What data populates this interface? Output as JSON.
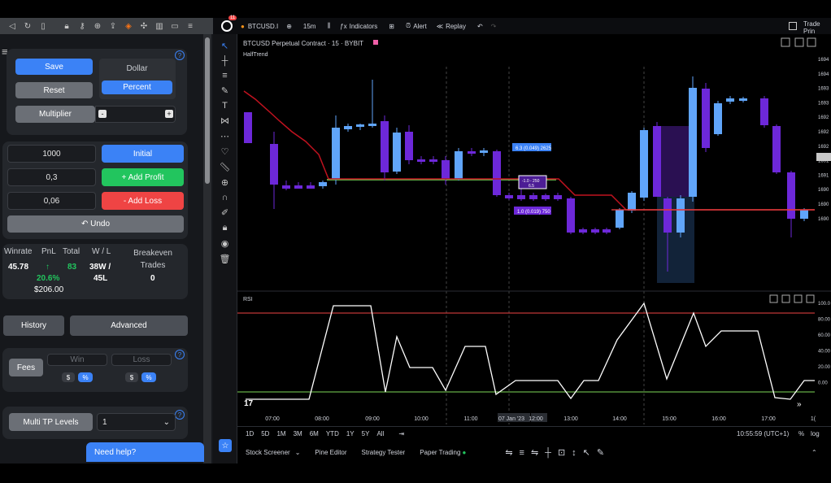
{
  "browser": {
    "icons": [
      "back-icon",
      "reload-icon",
      "bookmark-icon",
      "lock-icon",
      "key-icon",
      "zoom-icon",
      "share-icon",
      "brave-icon",
      "extensions-icon",
      "sidebar-icon",
      "wallet-icon",
      "menu-icon"
    ]
  },
  "panel": {
    "save": "Save",
    "reset": "Reset",
    "dollar": "Dollar",
    "percent": "Percent",
    "multiplier": "Multiplier",
    "minus": "-",
    "plus": "+",
    "input1": "1000",
    "initial": "Initial",
    "input2": "0,3",
    "add_profit": "+ Add Profit",
    "input3": "0,06",
    "add_loss": "- Add Loss",
    "undo": "↶ Undo",
    "stats": {
      "winrate_h": "Winrate",
      "pnl_h": "PnL",
      "total_h": "Total",
      "wl_h": "W / L",
      "be_h": "Breakeven Trades",
      "winrate": "45.78",
      "pnl_arrow": "↑",
      "pnl": "20.6%",
      "pnl_usd": "$206.00",
      "total": "83",
      "wins": "38W /",
      "losses": "45L",
      "be": "0"
    },
    "history": "History",
    "advanced": "Advanced",
    "fees": "Fees",
    "win": "Win",
    "loss": "Loss",
    "dollar_sym": "$",
    "pct_sym": "%",
    "multi_tp": "Multi TP Levels",
    "tp_value": "1",
    "help": "?",
    "need_help": "Need help?"
  },
  "chart": {
    "badge": "11",
    "symbol": "BTCUSD.I",
    "timeframe": "15m",
    "indicators": "Indicators",
    "alert": "Alert",
    "replay": "Replay",
    "trade_label": "Trade Prin",
    "title": "BTCUSD Perpetual Contract · 15 · BYBIT",
    "indicator": "HalfTrend",
    "rsi": "RSI",
    "time_labels": [
      "07:00",
      "08:00",
      "09:00",
      "10:00",
      "11:00",
      "07 Jan '23",
      "12:00",
      "13:00",
      "14:00",
      "15:00",
      "16:00",
      "17:00",
      "1("
    ],
    "ranges": [
      "1D",
      "5D",
      "1M",
      "3M",
      "6M",
      "YTD",
      "1Y",
      "5Y",
      "All"
    ],
    "clock": "10:55:59 (UTC+1)",
    "pct": "%",
    "log": "log",
    "tabs": [
      "Stock Screener",
      "Pine Editor",
      "Strategy Tester",
      "Paper Trading"
    ],
    "price_labels": [
      "1694",
      "1694",
      "1693",
      "1693",
      "1692",
      "1692",
      "1692",
      "1691",
      "1691",
      "1690",
      "1690",
      "1690"
    ],
    "rsi_labels": [
      "100.0",
      "80.00",
      "60.00",
      "40.00",
      "20.00",
      "0.00"
    ],
    "tp_label": "6.3 (0.049) 2625",
    "mid_label": "-1.0 - 250",
    "mid_val": "6.5",
    "sl_label": "1.0 (0.019) 750"
  }
}
